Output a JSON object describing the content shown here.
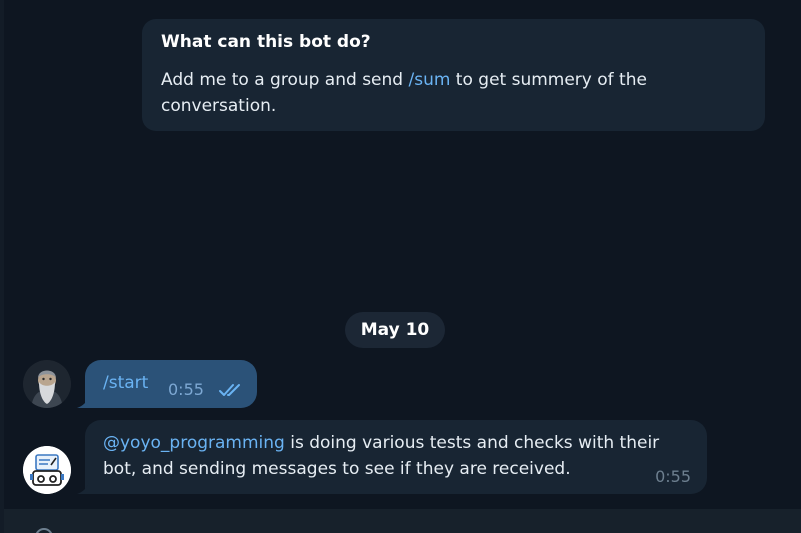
{
  "info_card": {
    "title": "What can this bot do?",
    "body_before": "Add me to a group and send ",
    "command": "/sum",
    "body_after": " to get summery of the conversation."
  },
  "date_separator": "May 10",
  "messages": [
    {
      "direction": "outgoing",
      "text": "/start",
      "time": "0:55",
      "status": "read"
    },
    {
      "direction": "incoming",
      "mention": "@yoyo_programming",
      "text": " is doing various tests and checks with their bot, and sending messages to see if they are received.",
      "time": "0:55"
    }
  ],
  "colors": {
    "background": "#0e1621",
    "bubble_in": "#182533",
    "bubble_out": "#2b5278",
    "link": "#6ab3f3"
  },
  "icons": {
    "read_status": "double-check-icon",
    "composer": "emoji-icon"
  }
}
